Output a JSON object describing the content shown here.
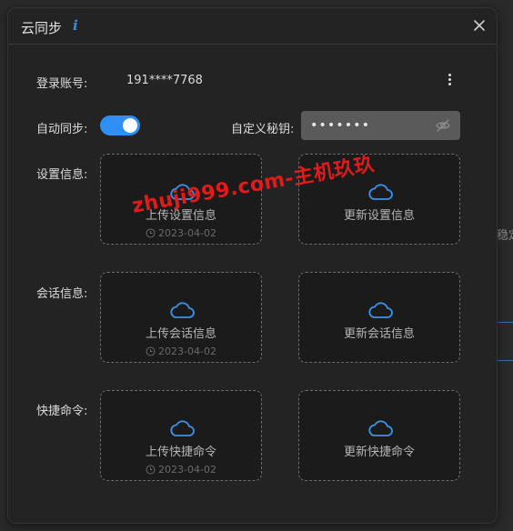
{
  "dialog": {
    "title": "云同步",
    "info_icon": "info-icon",
    "close_icon": "close-icon"
  },
  "account": {
    "label": "登录账号:",
    "value": "191****7768",
    "menu_icon": "more-vertical-icon"
  },
  "auto_sync": {
    "label": "自动同步:",
    "enabled": true
  },
  "secret": {
    "label": "自定义秘钥:",
    "value": "•••••••",
    "toggle_icon": "eye-off-icon"
  },
  "sections": [
    {
      "label": "设置信息:",
      "upload": {
        "label": "上传设置信息",
        "date": "2023-04-02",
        "icon": "cloud-icon"
      },
      "update": {
        "label": "更新设置信息",
        "icon": "cloud-icon"
      }
    },
    {
      "label": "会话信息:",
      "upload": {
        "label": "上传会话信息",
        "date": "2023-04-02",
        "icon": "cloud-icon"
      },
      "update": {
        "label": "更新会话信息",
        "icon": "cloud-icon"
      }
    },
    {
      "label": "快捷命令:",
      "upload": {
        "label": "上传快捷命令",
        "date": "2023-04-02",
        "icon": "cloud-icon"
      },
      "update": {
        "label": "更新快捷命令",
        "icon": "cloud-icon"
      }
    }
  ],
  "background": {
    "partial_text": "稳定"
  },
  "watermark": {
    "text": "zhuji999.com-主机玖玖"
  },
  "colors": {
    "accent": "#2f8ff2",
    "watermark": "#e11a1a",
    "dialog_bg": "#232323"
  }
}
